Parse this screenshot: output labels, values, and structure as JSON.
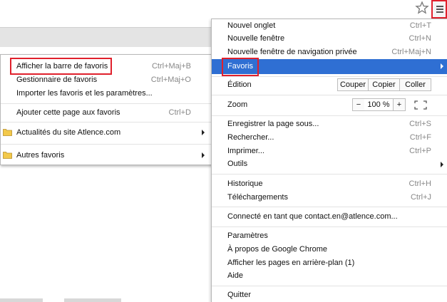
{
  "toolbar": {
    "star_icon": "star-icon",
    "menu_icon": "hamburger-menu-icon"
  },
  "colors": {
    "highlight": "#2f6fd3",
    "callout": "#e0202c"
  },
  "bookmarks_menu": {
    "items": [
      {
        "label": "Afficher la barre de favoris",
        "shortcut": "Ctrl+Maj+B"
      },
      {
        "label": "Gestionnaire de favoris",
        "shortcut": "Ctrl+Maj+O"
      },
      {
        "label": "Importer les favoris et les paramètres...",
        "shortcut": ""
      },
      {
        "label": "Ajouter cette page aux favoris",
        "shortcut": "Ctrl+D"
      },
      {
        "label": "Actualités du site Atlence.com",
        "shortcut": ""
      },
      {
        "label": "Autres favoris",
        "shortcut": ""
      }
    ]
  },
  "main_menu": {
    "new_tab": {
      "label": "Nouvel onglet",
      "shortcut": "Ctrl+T"
    },
    "new_window": {
      "label": "Nouvelle fenêtre",
      "shortcut": "Ctrl+N"
    },
    "new_private": {
      "label": "Nouvelle fenêtre de navigation privée",
      "shortcut": "Ctrl+Maj+N"
    },
    "favoris": {
      "label": "Favoris"
    },
    "edition": {
      "label": "Édition",
      "cut": "Couper",
      "copy": "Copier",
      "paste": "Coller"
    },
    "zoom": {
      "label": "Zoom",
      "minus": "−",
      "value": "100 %",
      "plus": "+"
    },
    "save_page": {
      "label": "Enregistrer la page sous...",
      "shortcut": "Ctrl+S"
    },
    "find": {
      "label": "Rechercher...",
      "shortcut": "Ctrl+F"
    },
    "print": {
      "label": "Imprimer...",
      "shortcut": "Ctrl+P"
    },
    "tools": {
      "label": "Outils"
    },
    "history": {
      "label": "Historique",
      "shortcut": "Ctrl+H"
    },
    "downloads": {
      "label": "Téléchargements",
      "shortcut": "Ctrl+J"
    },
    "signed_in": {
      "label": "Connecté en tant que contact.en@atlence.com..."
    },
    "settings": {
      "label": "Paramètres"
    },
    "about": {
      "label": "À propos de Google Chrome"
    },
    "background_pages": {
      "label": "Afficher les pages en arrière-plan (1)"
    },
    "help": {
      "label": "Aide"
    },
    "quit": {
      "label": "Quitter"
    }
  }
}
